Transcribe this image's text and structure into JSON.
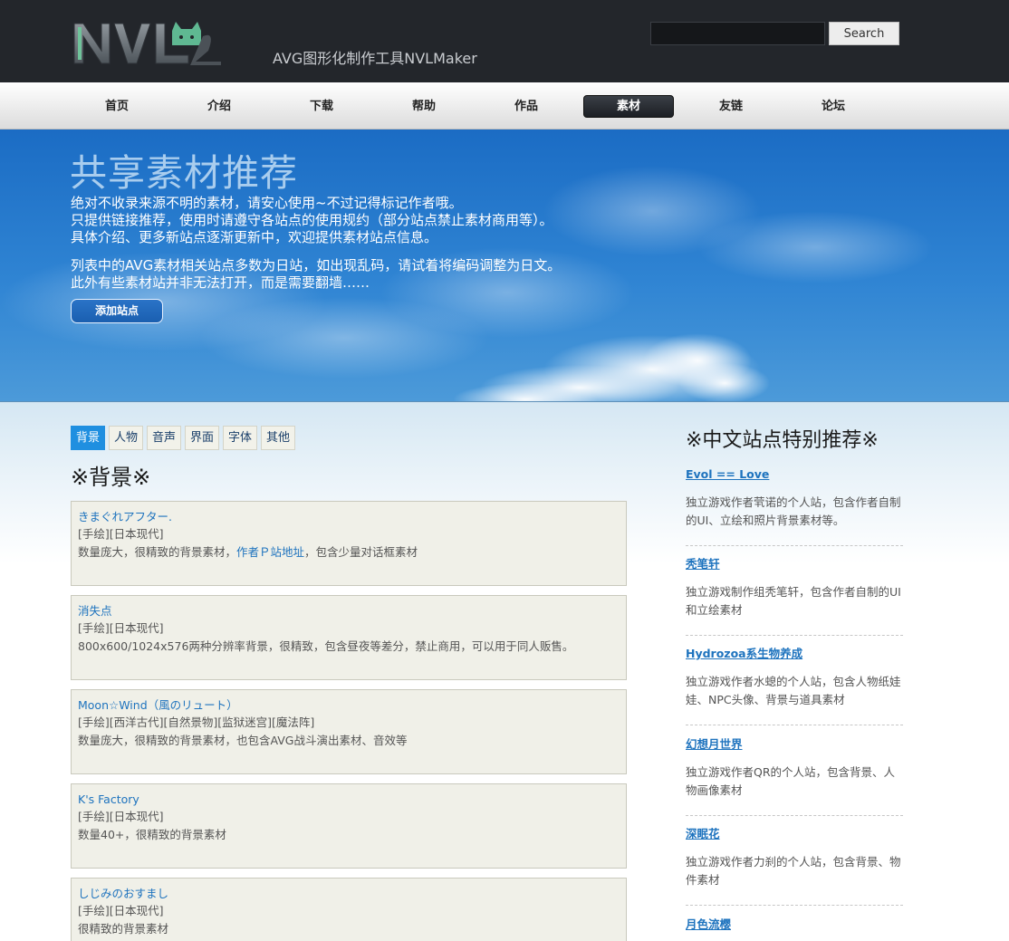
{
  "header": {
    "tagline": "AVG图形化制作工具NVLMaker",
    "search_value": "",
    "search_button": "Search"
  },
  "nav": {
    "items": [
      {
        "label": "首页"
      },
      {
        "label": "介绍"
      },
      {
        "label": "下载"
      },
      {
        "label": "帮助"
      },
      {
        "label": "作品"
      },
      {
        "label": "素材",
        "active": true
      },
      {
        "label": "友链"
      },
      {
        "label": "论坛"
      }
    ]
  },
  "banner": {
    "title": "共享素材推荐",
    "lines": [
      "绝对不收录来源不明的素材，请安心使用~不过记得标记作者哦。",
      "只提供链接推荐，使用时请遵守各站点的使用规约（部分站点禁止素材商用等）。",
      "具体介绍、更多新站点逐渐更新中，欢迎提供素材站点信息。",
      "列表中的AVG素材相关站点多数为日站，如出现乱码，请试着将编码调整为日文。",
      "此外有些素材站并非无法打开，而是需要翻墙……"
    ],
    "add_site_button": "添加站点"
  },
  "categories": {
    "tabs": [
      {
        "label": "背景",
        "active": true
      },
      {
        "label": "人物"
      },
      {
        "label": "音声"
      },
      {
        "label": "界面"
      },
      {
        "label": "字体"
      },
      {
        "label": "其他"
      }
    ],
    "section_title": "※背景※"
  },
  "resources": [
    {
      "name": "きまぐれアフター.",
      "tags": "[手绘][日本现代]",
      "desc_before": "数量庞大，很精致的背景素材，",
      "desc_link": "作者Ｐ站地址",
      "desc_after": "，包含少量对话框素材"
    },
    {
      "name": "消失点",
      "tags": "[手绘][日本现代]",
      "desc_before": "800x600/1024x576两种分辨率背景，很精致，包含昼夜等差分，禁止商用，可以用于同人贩售。",
      "desc_link": "",
      "desc_after": ""
    },
    {
      "name": "Moon☆Wind（風のリュート）",
      "tags": "[手绘][西洋古代][自然景物][监狱迷宫][魔法阵]",
      "desc_before": "数量庞大，很精致的背景素材，也包含AVG战斗演出素材、音效等",
      "desc_link": "",
      "desc_after": ""
    },
    {
      "name": "K's Factory",
      "tags": "[手绘][日本现代]",
      "desc_before": "数量40+，很精致的背景素材",
      "desc_link": "",
      "desc_after": ""
    },
    {
      "name": "しじみのおすまし",
      "tags": "[手绘][日本现代]",
      "desc_before": "很精致的背景素材",
      "desc_link": "",
      "desc_after": ""
    }
  ],
  "sidebar": {
    "title": "※中文站点特别推荐※",
    "items": [
      {
        "name": "Evol == Love",
        "desc": "独立游戏作者茕诺的个人站，包含作者自制的UI、立绘和照片背景素材等。"
      },
      {
        "name": "秃笔轩",
        "desc": "独立游戏制作组秃笔轩，包含作者自制的UI和立绘素材"
      },
      {
        "name": "Hydrozoa系生物养成",
        "desc": "独立游戏作者水螅的个人站，包含人物纸娃娃、NPC头像、背景与道具素材"
      },
      {
        "name": "幻想月世界",
        "desc": "独立游戏作者QR的个人站，包含背景、人物画像素材"
      },
      {
        "name": "深眠花",
        "desc": "独立游戏作者力刹的个人站，包含背景、物件素材"
      },
      {
        "name": "月色流樱",
        "desc": ""
      }
    ]
  },
  "colors": {
    "header_bg": "#23262b",
    "banner_blue": "#1b6cc4",
    "link_blue": "#1e73be",
    "active_tab": "#1f8fe0",
    "card_bg": "#f0f0e8"
  }
}
